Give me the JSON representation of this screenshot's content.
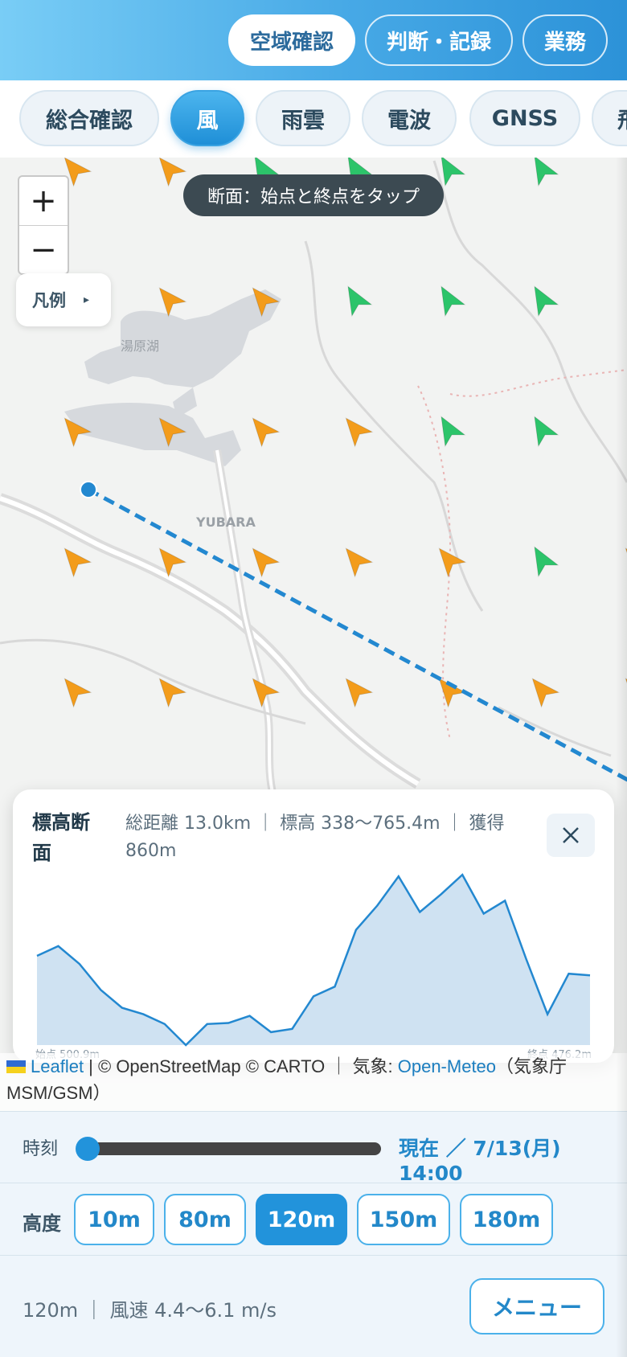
{
  "top_nav": {
    "buttons": [
      {
        "label": "空域確認",
        "active": true
      },
      {
        "label": "判断・記録",
        "active": false
      },
      {
        "label": "業務",
        "active": false
      }
    ]
  },
  "layer_tabs": [
    {
      "label": "総合確認",
      "active": false
    },
    {
      "label": "風",
      "active": true
    },
    {
      "label": "雨雲",
      "active": false
    },
    {
      "label": "電波",
      "active": false
    },
    {
      "label": "GNSS",
      "active": false
    },
    {
      "label": "飛",
      "active": false
    }
  ],
  "map": {
    "zoom_in": "+",
    "zoom_out": "−",
    "legend_label": "凡例",
    "legend_arrow": "▸",
    "hint": "断面：始点と終点をタップ",
    "labels": {
      "lake": "湯原湖",
      "town": "YUBARA"
    },
    "colors": {
      "wind_orange": "#f39c1b",
      "wind_green": "#2cc46a",
      "profile_line": "#2388d0"
    }
  },
  "elevation_panel": {
    "title": "標高断面",
    "stats": "総距離 13.0km ｜ 標高 338〜765.4m ｜ 獲得 860m",
    "start_label": "始点 500.9m",
    "end_label": "終点 476.2m",
    "close_icon": "close-icon"
  },
  "chart_data": {
    "type": "area",
    "title": "",
    "xlabel": "",
    "ylabel": "",
    "x": [
      0,
      0.5,
      1.0,
      1.5,
      2.0,
      2.5,
      3.0,
      3.5,
      4.0,
      4.5,
      5.0,
      5.5,
      6.0,
      6.5,
      7.0,
      7.5,
      8.0,
      8.5,
      9.0,
      9.5,
      10.0,
      10.5,
      11.0,
      11.5,
      12.0,
      12.5,
      13.0
    ],
    "values": [
      515,
      545,
      490,
      410,
      355,
      335,
      305,
      240,
      305,
      308,
      330,
      280,
      290,
      390,
      420,
      595,
      670,
      760,
      650,
      705,
      765,
      645,
      685,
      505,
      335,
      460,
      455
    ],
    "ylim": [
      240,
      780
    ],
    "series_color": "#2388d0",
    "fill_color": "#cfe2f2"
  },
  "attribution": {
    "leaflet": "Leaflet",
    "sep1": " | © OpenStreetMap © CARTO ｜ 気象: ",
    "meteo": "Open-Meteo",
    "tail": "（気象庁MSM/GSM）"
  },
  "time_control": {
    "label": "時刻",
    "value_text": "現在 ／ 7/13(月) 14:00",
    "position": 0.0
  },
  "altitude_control": {
    "label": "高度",
    "options": [
      {
        "label": "10m",
        "active": false
      },
      {
        "label": "80m",
        "active": false
      },
      {
        "label": "120m",
        "active": true
      },
      {
        "label": "150m",
        "active": false
      },
      {
        "label": "180m",
        "active": false
      }
    ]
  },
  "footer": {
    "status": "120m ｜ 風速 4.4〜6.1 m/s",
    "menu_label": "メニュー"
  }
}
